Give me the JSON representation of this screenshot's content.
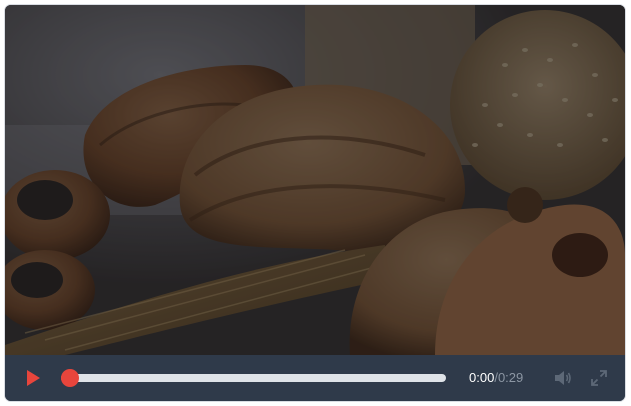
{
  "player": {
    "current_time": "0:00",
    "separator": "/",
    "duration": "0:29",
    "progress": 0.0
  },
  "icons": {
    "play": "play-icon",
    "volume": "volume-icon",
    "fullscreen": "fullscreen-icon"
  },
  "colors": {
    "accent": "#e8453c",
    "controls_bg": "#2f3a4a",
    "track": "#dfe3e8",
    "muted_text": "#8c96a3"
  }
}
